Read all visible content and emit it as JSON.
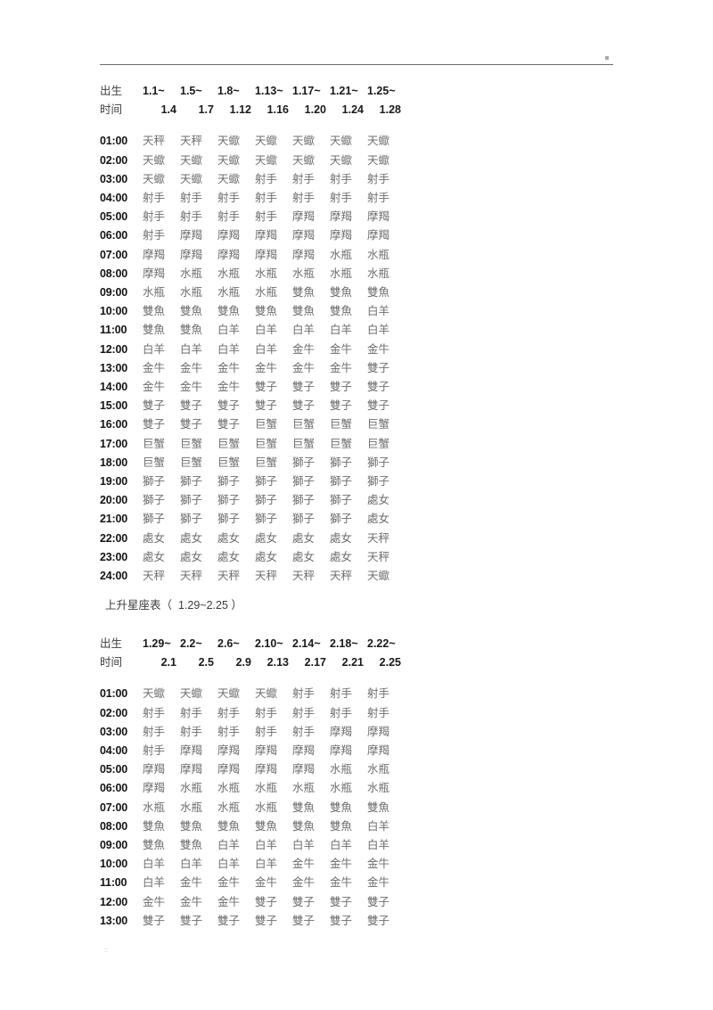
{
  "page": {
    "header_mark": "",
    "footer_mark": "::"
  },
  "table1": {
    "labels": {
      "birth": "出生",
      "time": "时间"
    },
    "date_ranges_start": [
      "1.1~",
      "1.5~",
      "1.8~",
      "1.13~",
      "1.17~",
      "1.21~",
      "1.25~"
    ],
    "date_ranges_end": [
      "1.4",
      "1.7",
      "1.12",
      "1.16",
      "1.20",
      "1.24",
      "1.28"
    ],
    "rows": [
      {
        "time": "01:00",
        "signs": [
          "天秤",
          "天秤",
          "天蠍",
          "天蠍",
          "天蠍",
          "天蠍",
          "天蠍"
        ]
      },
      {
        "time": "02:00",
        "signs": [
          "天蠍",
          "天蠍",
          "天蠍",
          "天蠍",
          "天蠍",
          "天蠍",
          "天蠍"
        ]
      },
      {
        "time": "03:00",
        "signs": [
          "天蠍",
          "天蠍",
          "天蠍",
          "射手",
          "射手",
          "射手",
          "射手"
        ]
      },
      {
        "time": "04:00",
        "signs": [
          "射手",
          "射手",
          "射手",
          "射手",
          "射手",
          "射手",
          "射手"
        ]
      },
      {
        "time": "05:00",
        "signs": [
          "射手",
          "射手",
          "射手",
          "射手",
          "摩羯",
          "摩羯",
          "摩羯"
        ]
      },
      {
        "time": "06:00",
        "signs": [
          "射手",
          "摩羯",
          "摩羯",
          "摩羯",
          "摩羯",
          "摩羯",
          "摩羯"
        ]
      },
      {
        "time": "07:00",
        "signs": [
          "摩羯",
          "摩羯",
          "摩羯",
          "摩羯",
          "摩羯",
          "水瓶",
          "水瓶"
        ]
      },
      {
        "time": "08:00",
        "signs": [
          "摩羯",
          "水瓶",
          "水瓶",
          "水瓶",
          "水瓶",
          "水瓶",
          "水瓶"
        ]
      },
      {
        "time": "09:00",
        "signs": [
          "水瓶",
          "水瓶",
          "水瓶",
          "水瓶",
          "雙魚",
          "雙魚",
          "雙魚"
        ]
      },
      {
        "time": "10:00",
        "signs": [
          "雙魚",
          "雙魚",
          "雙魚",
          "雙魚",
          "雙魚",
          "雙魚",
          "白羊"
        ]
      },
      {
        "time": "11:00",
        "signs": [
          "雙魚",
          "雙魚",
          "白羊",
          "白羊",
          "白羊",
          "白羊",
          "白羊"
        ]
      },
      {
        "time": "12:00",
        "signs": [
          "白羊",
          "白羊",
          "白羊",
          "白羊",
          "金牛",
          "金牛",
          "金牛"
        ]
      },
      {
        "time": "13:00",
        "signs": [
          "金牛",
          "金牛",
          "金牛",
          "金牛",
          "金牛",
          "金牛",
          "雙子"
        ]
      },
      {
        "time": "14:00",
        "signs": [
          "金牛",
          "金牛",
          "金牛",
          "雙子",
          "雙子",
          "雙子",
          "雙子"
        ]
      },
      {
        "time": "15:00",
        "signs": [
          "雙子",
          "雙子",
          "雙子",
          "雙子",
          "雙子",
          "雙子",
          "雙子"
        ]
      },
      {
        "time": "16:00",
        "signs": [
          "雙子",
          "雙子",
          "雙子",
          "巨蟹",
          "巨蟹",
          "巨蟹",
          "巨蟹"
        ]
      },
      {
        "time": "17:00",
        "signs": [
          "巨蟹",
          "巨蟹",
          "巨蟹",
          "巨蟹",
          "巨蟹",
          "巨蟹",
          "巨蟹"
        ]
      },
      {
        "time": "18:00",
        "signs": [
          "巨蟹",
          "巨蟹",
          "巨蟹",
          "巨蟹",
          "獅子",
          "獅子",
          "獅子"
        ]
      },
      {
        "time": "19:00",
        "signs": [
          "獅子",
          "獅子",
          "獅子",
          "獅子",
          "獅子",
          "獅子",
          "獅子"
        ]
      },
      {
        "time": "20:00",
        "signs": [
          "獅子",
          "獅子",
          "獅子",
          "獅子",
          "獅子",
          "獅子",
          "處女"
        ]
      },
      {
        "time": "21:00",
        "signs": [
          "獅子",
          "獅子",
          "獅子",
          "獅子",
          "獅子",
          "獅子",
          "處女"
        ]
      },
      {
        "time": "22:00",
        "signs": [
          "處女",
          "處女",
          "處女",
          "處女",
          "處女",
          "處女",
          "天秤"
        ]
      },
      {
        "time": "23:00",
        "signs": [
          "處女",
          "處女",
          "處女",
          "處女",
          "處女",
          "處女",
          "天秤"
        ]
      },
      {
        "time": "24:00",
        "signs": [
          "天秤",
          "天秤",
          "天秤",
          "天秤",
          "天秤",
          "天秤",
          "天蠍"
        ]
      }
    ]
  },
  "section2": {
    "title": "上升星座表（  1.29~2.25 ）"
  },
  "table2": {
    "labels": {
      "birth": "出生",
      "time": "时间"
    },
    "date_ranges_start": [
      "1.29~",
      "2.2~",
      "2.6~",
      "2.10~",
      "2.14~",
      "2.18~",
      "2.22~"
    ],
    "date_ranges_end": [
      "2.1",
      "2.5",
      "2.9",
      "2.13",
      "2.17",
      "2.21",
      "2.25"
    ],
    "rows": [
      {
        "time": "01:00",
        "signs": [
          "天蠍",
          "天蠍",
          "天蠍",
          "天蠍",
          "射手",
          "射手",
          "射手"
        ]
      },
      {
        "time": "02:00",
        "signs": [
          "射手",
          "射手",
          "射手",
          "射手",
          "射手",
          "射手",
          "射手"
        ]
      },
      {
        "time": "03:00",
        "signs": [
          "射手",
          "射手",
          "射手",
          "射手",
          "射手",
          "摩羯",
          "摩羯"
        ]
      },
      {
        "time": "04:00",
        "signs": [
          "射手",
          "摩羯",
          "摩羯",
          "摩羯",
          "摩羯",
          "摩羯",
          "摩羯"
        ]
      },
      {
        "time": "05:00",
        "signs": [
          "摩羯",
          "摩羯",
          "摩羯",
          "摩羯",
          "摩羯",
          "水瓶",
          "水瓶"
        ]
      },
      {
        "time": "06:00",
        "signs": [
          "摩羯",
          "水瓶",
          "水瓶",
          "水瓶",
          "水瓶",
          "水瓶",
          "水瓶"
        ]
      },
      {
        "time": "07:00",
        "signs": [
          "水瓶",
          "水瓶",
          "水瓶",
          "水瓶",
          "雙魚",
          "雙魚",
          "雙魚"
        ]
      },
      {
        "time": "08:00",
        "signs": [
          "雙魚",
          "雙魚",
          "雙魚",
          "雙魚",
          "雙魚",
          "雙魚",
          "白羊"
        ]
      },
      {
        "time": "09:00",
        "signs": [
          "雙魚",
          "雙魚",
          "白羊",
          "白羊",
          "白羊",
          "白羊",
          "白羊"
        ]
      },
      {
        "time": "10:00",
        "signs": [
          "白羊",
          "白羊",
          "白羊",
          "白羊",
          "金牛",
          "金牛",
          "金牛"
        ]
      },
      {
        "time": "11:00",
        "signs": [
          "白羊",
          "金牛",
          "金牛",
          "金牛",
          "金牛",
          "金牛",
          "金牛"
        ]
      },
      {
        "time": "12:00",
        "signs": [
          "金牛",
          "金牛",
          "金牛",
          "雙子",
          "雙子",
          "雙子",
          "雙子"
        ]
      },
      {
        "time": "13:00",
        "signs": [
          "雙子",
          "雙子",
          "雙子",
          "雙子",
          "雙子",
          "雙子",
          "雙子"
        ]
      }
    ]
  }
}
